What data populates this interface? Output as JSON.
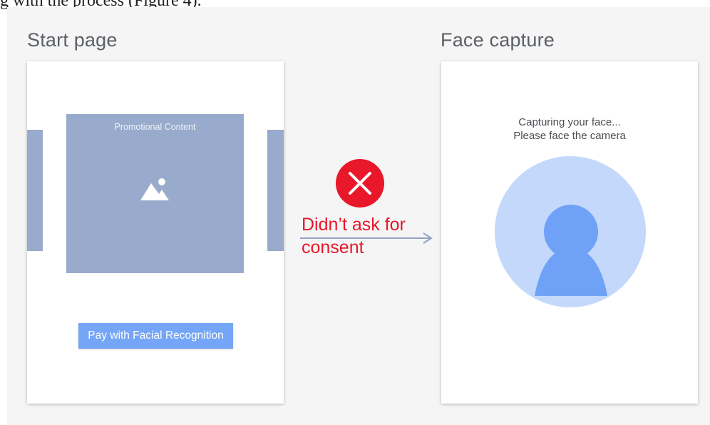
{
  "caption_fragment": "g with the process (Figure 4).",
  "start_screen": {
    "title": "Start page",
    "promo_label": "Promotional Content",
    "pay_button_label": "Pay with Facial Recognition"
  },
  "face_screen": {
    "title": "Face capture",
    "instruction_line1": "Capturing your face...",
    "instruction_line2": "Please face the camera"
  },
  "transition": {
    "label_line1": "Didn’t ask for",
    "label_line2": "consent",
    "status_icon": "x-circle-icon"
  },
  "colors": {
    "card": "#98abcc",
    "button": "#74a5f7",
    "error": "#e8172a",
    "avatar_circle": "#c4d8fb",
    "avatar_figure": "#6fa2f6"
  }
}
